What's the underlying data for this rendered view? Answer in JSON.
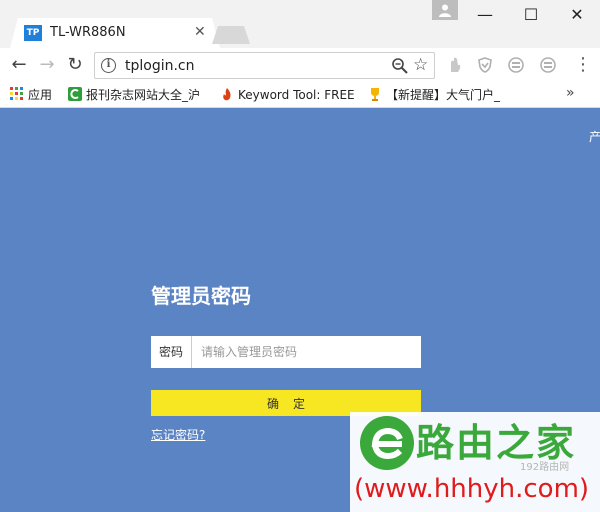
{
  "browser": {
    "tab": {
      "favicon_text": "TP",
      "title": "TL-WR886N",
      "close": "✕"
    },
    "window_controls": {
      "minimize": "—",
      "maximize": "☐",
      "close": "✕"
    },
    "address": {
      "url": "tplogin.cn"
    },
    "bookmarks": [
      {
        "label": "应用",
        "icon": "apps-grid-icon"
      },
      {
        "label": "报刊杂志网站大全_沪",
        "icon": "green-c-icon"
      },
      {
        "label": "Keyword Tool: FREE",
        "icon": "flame-icon"
      },
      {
        "label": "【新提醒】大气门户_",
        "icon": "trophy-icon"
      }
    ],
    "bookmarks_more": "»"
  },
  "page": {
    "corner_text": "产",
    "title": "管理员密码",
    "password_label": "密码",
    "password_placeholder": "请输入管理员密码",
    "confirm_label": "确定",
    "forgot_link": "忘记密码?"
  },
  "watermark": {
    "title": "路由之家",
    "subtitle": "192路由网",
    "url": "(www.hhhyh.com)"
  },
  "colors": {
    "page_bg": "#5b84c4",
    "button_yellow": "#f7e622",
    "watermark_green": "#3aa83a",
    "watermark_red": "#e01b1b"
  }
}
